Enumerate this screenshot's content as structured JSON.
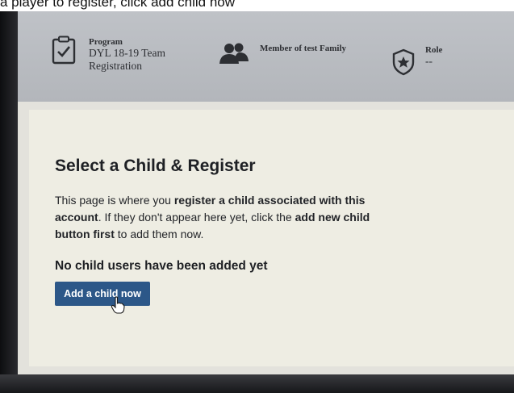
{
  "caption": "a player to register, click add child now",
  "header": {
    "program_label": "Program",
    "program_value": "DYL 18-19 Team Registration",
    "member_label": "Member of test Family",
    "role_label": "Role",
    "role_value": "--"
  },
  "main": {
    "title": "Select a Child & Register",
    "description": {
      "part1": "This page is where you ",
      "bold1": "register a child associated with this account",
      "part2": ". If they don't appear here yet, click the ",
      "bold2": "add new child button first",
      "part3": " to add them now."
    },
    "empty_message": "No child users have been added yet",
    "add_button_label": "Add a child now"
  },
  "icons": {
    "program": "clipboard-check-icon",
    "member": "users-icon",
    "role": "star-badge-icon",
    "cursor": "hand-pointer-icon"
  }
}
